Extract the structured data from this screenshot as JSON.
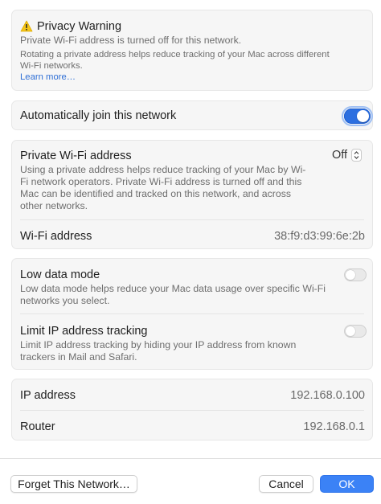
{
  "warning": {
    "title": "Privacy Warning",
    "line1": "Private Wi-Fi address is turned off for this network.",
    "line2": "Rotating a private address helps reduce tracking of your Mac across different",
    "line3": "Wi-Fi networks.",
    "link": "Learn more…"
  },
  "auto_join": {
    "label": "Automatically join this network",
    "enabled": true
  },
  "private_address": {
    "label": "Private Wi-Fi address",
    "value": "Off",
    "desc1": "Using a private address helps reduce tracking of your Mac by Wi-",
    "desc2": "Fi network operators. Private Wi-Fi address is turned off and this",
    "desc3": "Mac can be identified and tracked on this network, and across",
    "desc4": "other networks."
  },
  "wifi_address": {
    "label": "Wi-Fi address",
    "value": "38:f9:d3:99:6e:2b"
  },
  "low_data": {
    "label": "Low data mode",
    "desc1": "Low data mode helps reduce your Mac data usage over specific Wi-Fi",
    "desc2": "networks you select.",
    "enabled": false
  },
  "limit_ip": {
    "label": "Limit IP address tracking",
    "desc1": "Limit IP address tracking by hiding your IP address from known",
    "desc2": "trackers in Mail and Safari.",
    "enabled": false
  },
  "network": {
    "ip_label": "IP address",
    "ip_value": "192.168.0.100",
    "router_label": "Router",
    "router_value": "192.168.0.1"
  },
  "footer": {
    "forget": "Forget This Network…",
    "cancel": "Cancel",
    "ok": "OK"
  },
  "colors": {
    "accent": "#3b82f6",
    "warning": "#f5c518",
    "link": "#2f6fd6"
  }
}
